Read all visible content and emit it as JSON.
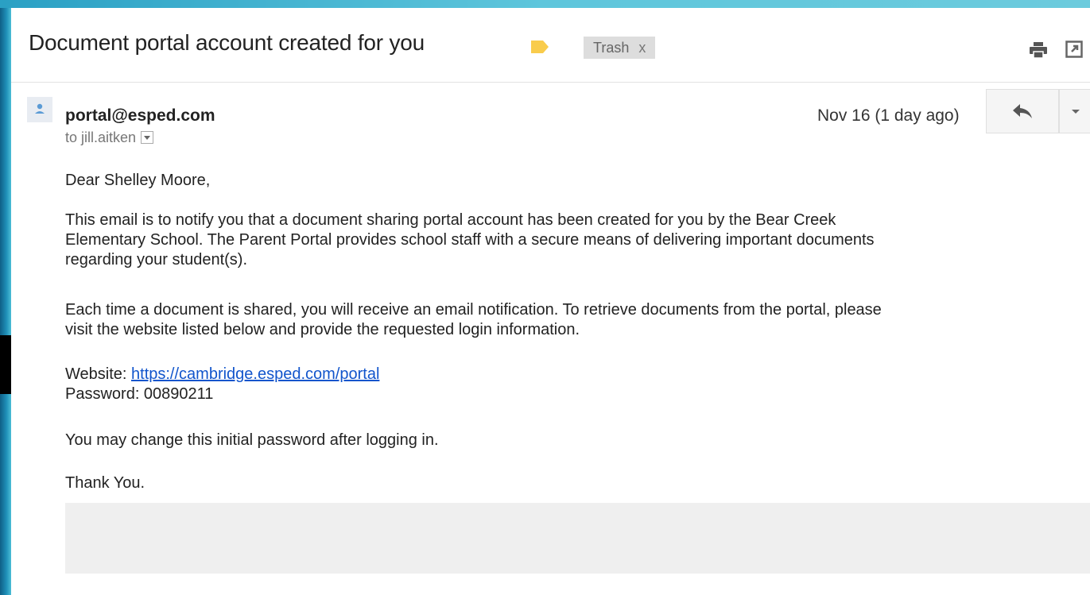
{
  "email": {
    "subject": "Document portal account created for you",
    "label_chip": {
      "text": "Trash",
      "remove": "x"
    },
    "sender": "portal@esped.com",
    "to_line": "to jill.aitken",
    "date": "Nov 16 (1 day ago)",
    "body": {
      "greeting": "Dear Shelley Moore,",
      "para1_lines": [
        "This email is to notify you that a document sharing portal account has been created for you by the Bear Creek",
        "Elementary School.  The Parent Portal provides school staff with a secure means of delivering important documents",
        "regarding your student(s)."
      ],
      "para2_lines": [
        "Each time a document is shared, you will receive an email notification.  To retrieve documents from the portal, please",
        "visit the website listed below and provide the requested login information."
      ],
      "website_label": "Website:",
      "website_url": "https://cambridge.esped.com/portal",
      "password_line": "Password: 00890211",
      "change_note": "You may change this initial password after logging in.",
      "closing": "Thank You."
    }
  },
  "icons": {
    "label": "label-tag-icon",
    "print": "print-icon",
    "new_window": "new-window-icon",
    "avatar": "person-icon",
    "reply": "reply-arrow-icon",
    "more": "chevron-down-icon"
  },
  "colors": {
    "label_tag": "#f9cc4c",
    "link": "#1155cc",
    "chip_bg": "#dddddd",
    "frame": "#4cbdd6"
  }
}
